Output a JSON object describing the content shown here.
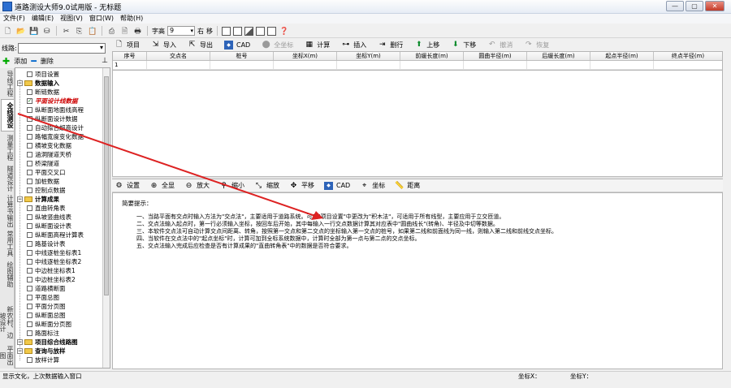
{
  "window": {
    "title": "道路测设大师9.0试用版 - 无标题",
    "min": "—",
    "max": "▢",
    "close": "✕"
  },
  "menu": [
    "文件(F)",
    "编辑(E)",
    "视图(V)",
    "窗口(W)",
    "帮助(H)"
  ],
  "toolbar": {
    "font_label": "字高",
    "font_value": "9",
    "right_label": "右",
    "move_label": "移"
  },
  "left": {
    "line_label": "线路:",
    "add_label": "添加",
    "delete_label": "删除",
    "vtabs": [
      "导线工程",
      "全线测设",
      "测量工程",
      "隧道设计",
      "计算书输出",
      "常用工具",
      "绘图辅助",
      "新农村、边坡设计",
      "平面出图"
    ],
    "tree": [
      {
        "label": "项目设置",
        "level": 1,
        "kind": "item"
      },
      {
        "label": "数据输入",
        "level": 0,
        "kind": "group"
      },
      {
        "label": "断链数据",
        "level": 1,
        "kind": "item"
      },
      {
        "label": "平面设计线数据",
        "level": 1,
        "kind": "item",
        "checked": true,
        "selected": true
      },
      {
        "label": "纵断面地面线高程",
        "level": 1,
        "kind": "item"
      },
      {
        "label": "纵断面设计数据",
        "level": 1,
        "kind": "item"
      },
      {
        "label": "自动拟合超高设计",
        "level": 1,
        "kind": "item"
      },
      {
        "label": "路幅宽度变化数据",
        "level": 1,
        "kind": "item"
      },
      {
        "label": "横坡变化数据",
        "level": 1,
        "kind": "item"
      },
      {
        "label": "涵洞隧道天桥",
        "level": 1,
        "kind": "item"
      },
      {
        "label": "桥梁隧道",
        "level": 1,
        "kind": "item"
      },
      {
        "label": "平面交叉口",
        "level": 1,
        "kind": "item"
      },
      {
        "label": "加桩数据",
        "level": 1,
        "kind": "item"
      },
      {
        "label": "控制点数据",
        "level": 1,
        "kind": "item"
      },
      {
        "label": "计算成果",
        "level": 0,
        "kind": "group"
      },
      {
        "label": "直曲转角表",
        "level": 1,
        "kind": "item"
      },
      {
        "label": "纵坡竖曲线表",
        "level": 1,
        "kind": "item"
      },
      {
        "label": "纵断面设计表",
        "level": 1,
        "kind": "item"
      },
      {
        "label": "纵断面高程计算表",
        "level": 1,
        "kind": "item"
      },
      {
        "label": "路基设计表",
        "level": 1,
        "kind": "item"
      },
      {
        "label": "中线逐桩坐标表1",
        "level": 1,
        "kind": "item"
      },
      {
        "label": "中线逐桩坐标表2",
        "level": 1,
        "kind": "item"
      },
      {
        "label": "中边桩坐标表1",
        "level": 1,
        "kind": "item"
      },
      {
        "label": "中边桩坐标表2",
        "level": 1,
        "kind": "item"
      },
      {
        "label": "道路横断面",
        "level": 1,
        "kind": "item"
      },
      {
        "label": "平面总图",
        "level": 1,
        "kind": "item"
      },
      {
        "label": "平面分页图",
        "level": 1,
        "kind": "item"
      },
      {
        "label": "纵断面总图",
        "level": 1,
        "kind": "item"
      },
      {
        "label": "纵断面分页图",
        "level": 1,
        "kind": "item"
      },
      {
        "label": "路面标注",
        "level": 1,
        "kind": "item"
      },
      {
        "label": "项目综合线路图",
        "level": 0,
        "kind": "group"
      },
      {
        "label": "查询与放样",
        "level": 0,
        "kind": "group"
      },
      {
        "label": "放样计算",
        "level": 1,
        "kind": "item"
      }
    ]
  },
  "data_toolbar": [
    "项目",
    "导入",
    "导出",
    "CAD",
    "全坐标",
    "计算",
    "插入",
    "删行",
    "上移",
    "下移",
    "撤消",
    "恢复"
  ],
  "data_toolbar_disabled": [
    false,
    false,
    false,
    false,
    true,
    false,
    false,
    false,
    false,
    false,
    true,
    true
  ],
  "grid": {
    "columns": [
      "序号",
      "交点名",
      "桩号",
      "坐标X(m)",
      "坐标Y(m)",
      "前缓长度(m)",
      "圆曲半径(m)",
      "后缓长度(m)",
      "起点半径(m)",
      "终点半径(m)"
    ],
    "rows": [
      [
        "1",
        "",
        "",
        "",
        "",
        "",
        "",
        "",
        "",
        ""
      ]
    ]
  },
  "graphic_toolbar": [
    "设置",
    "全显",
    "放大",
    "缩小",
    "缩放",
    "平移",
    "CAD",
    "坐标",
    "距离"
  ],
  "tips": {
    "title": "简要提示：",
    "lines": [
      "一、当路平面有交点时输入方法为\"交点法\"，主要适用于道路系统。可在\"项目设置\"中更改为\"积木法\"，可适用于所有线型，主要应用于立交匝道。",
      "二、交点法输入起点时，第一行必须输入坐标，按回车后开始，其中每输入一行交点数据计算其对应表中\"圆曲线长\"(转角)、半径及中切等数据。",
      "三、本软件交点法可自动计算交点间距离、转角，按照第一交点和第二交点的坐标输入第一交点的桩号，如果第二线和前面线为同一线，则输入第二线和前线交点坐标。",
      "四、当软件在交点法中的\"起点坐标\"时，计算可加到全标系统数据中，计算时全部为第一点与第二点的交点坐标。",
      "五、交点法输入完成后应检查是否有计算成果的\"直曲转角表\"中的数据是否符合要求。"
    ]
  },
  "status": {
    "left": "显示文化，上次数据输入窗口",
    "x_label": "坐标X：",
    "y_label": "坐标Y："
  }
}
